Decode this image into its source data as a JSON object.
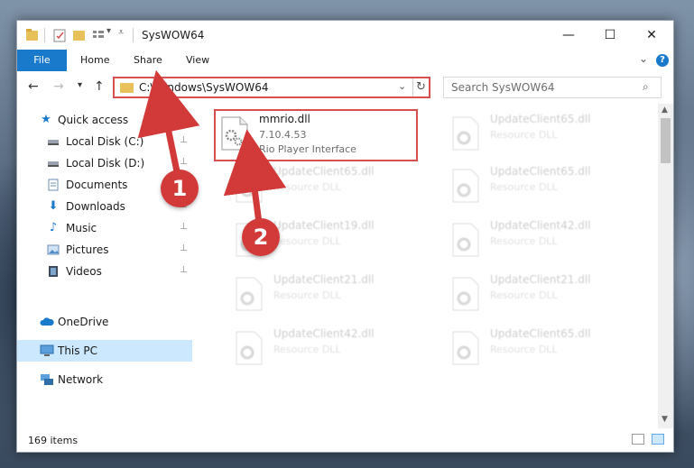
{
  "window": {
    "title": "SysWOW64",
    "controls": {
      "minimize": "—",
      "maximize": "☐",
      "close": "✕"
    }
  },
  "ribbon": {
    "tabs": [
      {
        "label": "File"
      },
      {
        "label": "Home"
      },
      {
        "label": "Share"
      },
      {
        "label": "View"
      }
    ],
    "help": "?"
  },
  "navigation": {
    "back": "←",
    "forward": "→",
    "recent": "▾",
    "up": "↑",
    "address": "C:\\Windows\\SysWOW64",
    "address_dropdown": "⌄",
    "refresh": "↻",
    "search_placeholder": "Search SysWOW64",
    "search_icon": "⌕"
  },
  "sidebar": {
    "items": [
      {
        "label": "Quick access",
        "icon": "star-icon",
        "pinned": false
      },
      {
        "label": "Local Disk (C:)",
        "icon": "drive-icon",
        "pinned": true
      },
      {
        "label": "Local Disk (D:)",
        "icon": "drive-icon",
        "pinned": true
      },
      {
        "label": "Documents",
        "icon": "documents-icon",
        "pinned": true
      },
      {
        "label": "Downloads",
        "icon": "downloads-icon",
        "pinned": true
      },
      {
        "label": "Music",
        "icon": "music-icon",
        "pinned": true
      },
      {
        "label": "Pictures",
        "icon": "pictures-icon",
        "pinned": true
      },
      {
        "label": "Videos",
        "icon": "videos-icon",
        "pinned": true
      },
      {
        "label": "OneDrive",
        "icon": "cloud-icon",
        "pinned": false
      },
      {
        "label": "This PC",
        "icon": "computer-icon",
        "pinned": false,
        "selected": true
      },
      {
        "label": "Network",
        "icon": "network-icon",
        "pinned": false
      }
    ],
    "pin_glyph": "📌"
  },
  "files": [
    {
      "name": "mmrio.dll",
      "version": "7.10.4.53",
      "description": "Rio Player Interface",
      "highlighted": true
    },
    {
      "name": "UpdateClient65.dll",
      "description": "Resource DLL"
    },
    {
      "name": "UpdateClient65.dll",
      "description": "Resource DLL"
    },
    {
      "name": "UpdateClient65.dll",
      "description": "Resource DLL"
    },
    {
      "name": "UpdateClient19.dll",
      "description": "Resource DLL"
    },
    {
      "name": "UpdateClient42.dll",
      "description": "Resource DLL"
    },
    {
      "name": "UpdateClient21.dll",
      "description": "Resource DLL"
    },
    {
      "name": "UpdateClient21.dll",
      "description": "Resource DLL"
    },
    {
      "name": "UpdateClient42.dll",
      "description": "Resource DLL"
    },
    {
      "name": "UpdateClient65.dll",
      "description": "Resource DLL"
    }
  ],
  "status": {
    "item_count": "169 items"
  },
  "annotations": [
    {
      "label": "1"
    },
    {
      "label": "2"
    }
  ],
  "colors": {
    "accent": "#1979ca",
    "annotation": "#d23a3a",
    "selection": "#cce8ff"
  }
}
